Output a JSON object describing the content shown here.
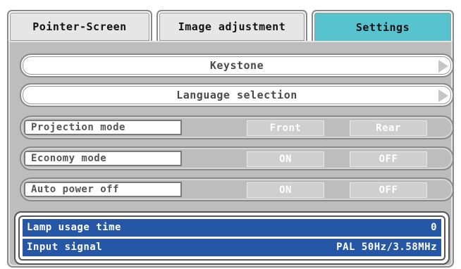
{
  "tabs": [
    {
      "label": "Pointer-Screen",
      "active": false
    },
    {
      "label": "Image adjustment",
      "active": false
    },
    {
      "label": "Settings",
      "active": true
    }
  ],
  "menu": {
    "keystone": {
      "label": "Keystone",
      "arrow_icon": "arrow-right-icon"
    },
    "language": {
      "label": "Language selection",
      "arrow_icon": "arrow-right-icon"
    }
  },
  "settings": {
    "projection": {
      "label": "Projection mode",
      "option1": "Front",
      "option2": "Rear"
    },
    "economy": {
      "label": "Economy mode",
      "option1": "ON",
      "option2": "OFF"
    },
    "autopower": {
      "label": "Auto power off",
      "option1": "ON",
      "option2": "OFF"
    }
  },
  "info": {
    "lamp_label": "Lamp usage time",
    "lamp_value": "0",
    "signal_label": "Input signal",
    "signal_value": "PAL 50Hz/3.58MHz"
  },
  "colors": {
    "active_tab": "#56c3cf",
    "info_bar": "#2657a7",
    "panel": "#bdbdbd"
  }
}
